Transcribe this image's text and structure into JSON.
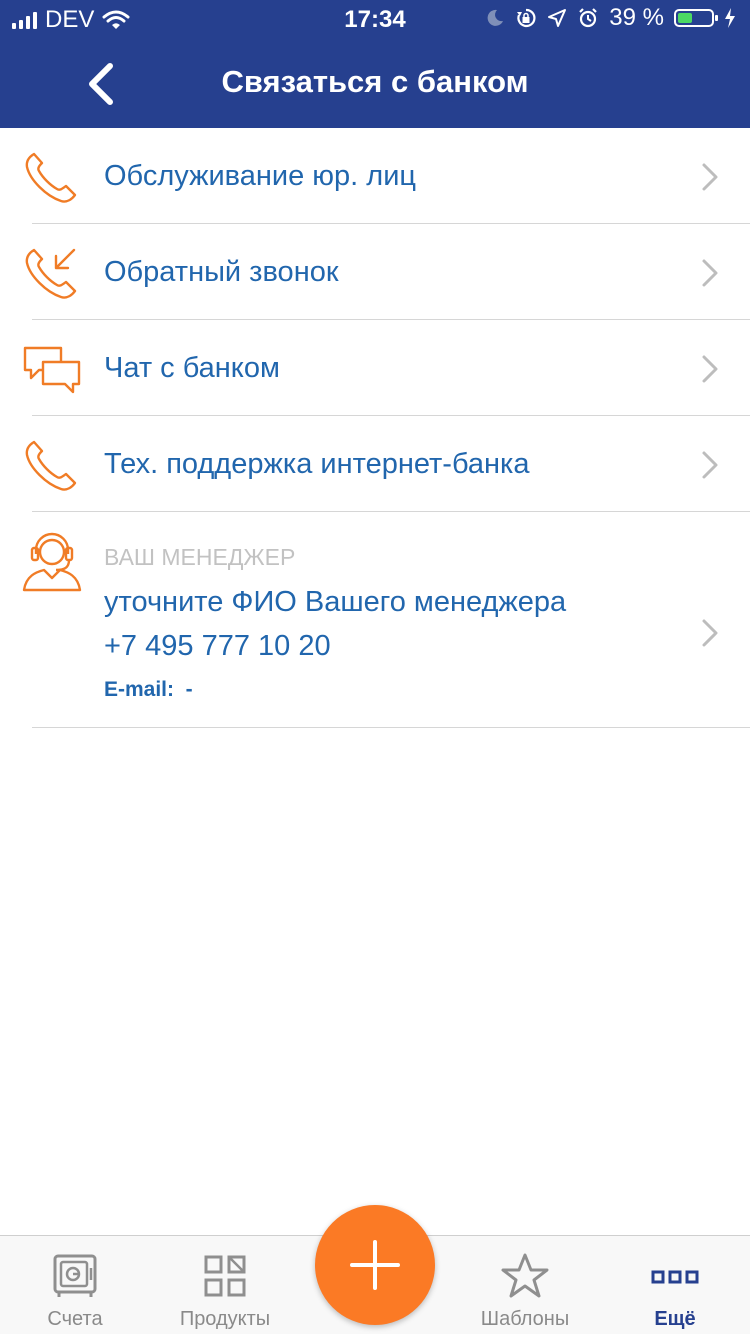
{
  "status_bar": {
    "carrier": "DEV",
    "time": "17:34",
    "battery": "39 %",
    "battery_level": 0.39
  },
  "header": {
    "title": "Связаться с банком"
  },
  "menu": [
    {
      "icon": "phone-icon",
      "label": "Обслуживание юр. лиц"
    },
    {
      "icon": "callback-icon",
      "label": "Обратный звонок"
    },
    {
      "icon": "chat-icon",
      "label": "Чат с банком"
    },
    {
      "icon": "phone-icon",
      "label": "Тех. поддержка интернет-банка"
    }
  ],
  "manager": {
    "icon": "headset-operator-icon",
    "caption": "ВАШ МЕНЕДЖЕР",
    "name": "уточните ФИО Вашего менеджера",
    "phone": "+7 495 777 10 20",
    "email": "E-mail:  -"
  },
  "tabbar": {
    "tabs": [
      {
        "icon": "safe-icon",
        "label": "Счета"
      },
      {
        "icon": "grid-icon",
        "label": "Продукты"
      },
      {
        "icon": "plus-icon",
        "label": ""
      },
      {
        "icon": "star-icon",
        "label": "Шаблоны"
      },
      {
        "icon": "more-icon",
        "label": "Ещё"
      }
    ],
    "active": 4
  },
  "colors": {
    "header_bg": "#26408f",
    "link": "#2166ad",
    "icon_accent": "#f07c26",
    "fab": "#fb7a25"
  }
}
